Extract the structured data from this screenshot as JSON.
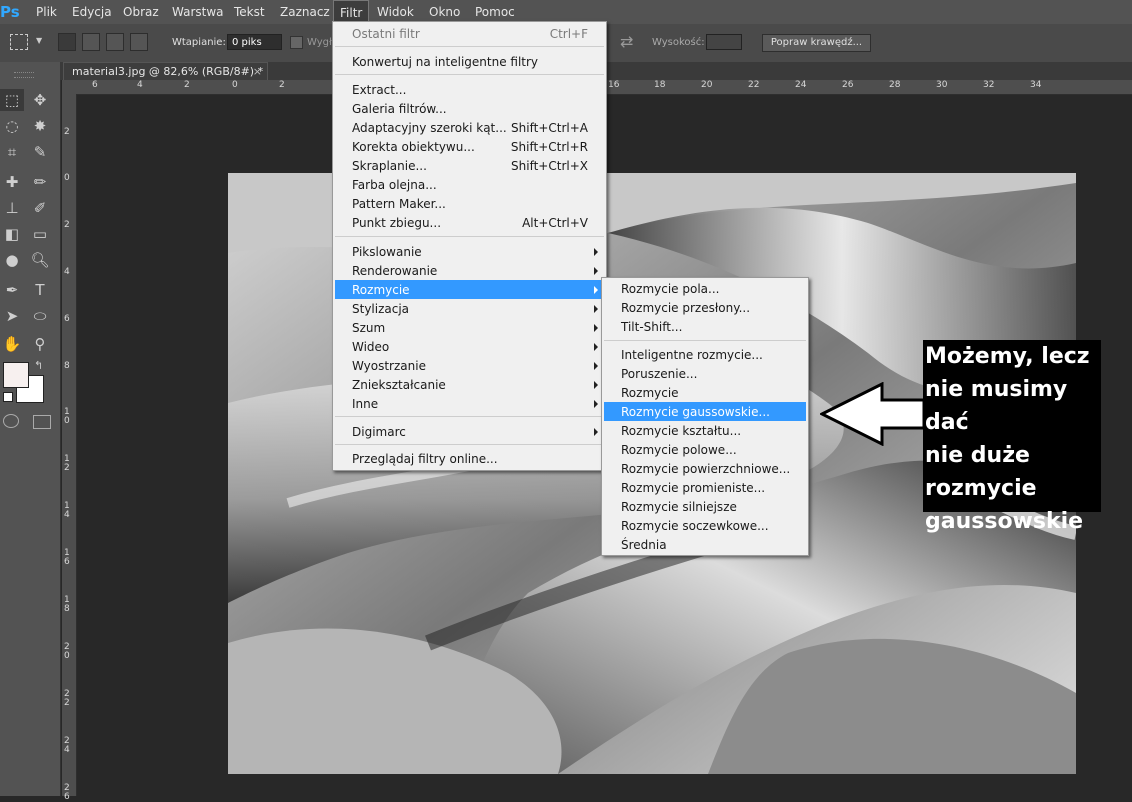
{
  "app": {
    "logo": "Ps"
  },
  "menubar": {
    "items": [
      "Plik",
      "Edycja",
      "Obraz",
      "Warstwa",
      "Tekst",
      "Zaznacz",
      "Filtr",
      "Widok",
      "Okno",
      "Pomoc"
    ],
    "active": "Filtr"
  },
  "options": {
    "feather_label": "Wtapianie:",
    "feather_value": "0 piks",
    "smooth_label": "Wygł",
    "height_label": "Wysokość:",
    "refine_button": "Popraw krawędź..."
  },
  "document": {
    "tab_title": "material3.jpg @ 82,6% (RGB/8#) *",
    "close_glyph": "×"
  },
  "rulers": {
    "h_ticks": [
      "6",
      "4",
      "2",
      "0",
      "2",
      "16",
      "18",
      "20",
      "22",
      "24",
      "26",
      "28",
      "30",
      "32",
      "34"
    ],
    "v_ticks": [
      "2",
      "0",
      "2",
      "4",
      "6",
      "8",
      "10",
      "12",
      "14",
      "16",
      "18",
      "20",
      "22",
      "24",
      "26"
    ]
  },
  "filter_menu": {
    "last_filter": {
      "label": "Ostatni filtr",
      "shortcut": "Ctrl+F"
    },
    "convert": "Konwertuj na inteligentne filtry",
    "group1": [
      {
        "label": "Extract...",
        "shortcut": ""
      },
      {
        "label": "Galeria filtrów...",
        "shortcut": ""
      },
      {
        "label": "Adaptacyjny szeroki kąt...",
        "shortcut": "Shift+Ctrl+A"
      },
      {
        "label": "Korekta obiektywu...",
        "shortcut": "Shift+Ctrl+R"
      },
      {
        "label": "Skraplanie...",
        "shortcut": "Shift+Ctrl+X"
      },
      {
        "label": "Farba olejna...",
        "shortcut": ""
      },
      {
        "label": "Pattern Maker...",
        "shortcut": ""
      },
      {
        "label": "Punkt zbiegu...",
        "shortcut": "Alt+Ctrl+V"
      }
    ],
    "group2": [
      "Pikslowanie",
      "Renderowanie",
      "Rozmycie",
      "Stylizacja",
      "Szum",
      "Wideo",
      "Wyostrzanie",
      "Zniekształcanie",
      "Inne"
    ],
    "digimarc": "Digimarc",
    "browse": "Przeglądaj filtry online...",
    "highlighted": "Rozmycie"
  },
  "blur_submenu": {
    "group1": [
      "Rozmycie pola...",
      "Rozmycie przesłony...",
      "Tilt-Shift..."
    ],
    "group2": [
      "Inteligentne rozmycie...",
      "Poruszenie...",
      "Rozmycie",
      "Rozmycie gaussowskie...",
      "Rozmycie kształtu...",
      "Rozmycie polowe...",
      "Rozmycie powierzchniowe...",
      "Rozmycie promieniste...",
      "Rozmycie silniejsze",
      "Rozmycie soczewkowe...",
      "Średnia"
    ],
    "highlighted": "Rozmycie gaussowskie..."
  },
  "annotation": {
    "lines": [
      "Możemy, lecz",
      "nie musimy dać",
      "nie duże",
      "rozmycie",
      "gaussowskie"
    ]
  },
  "colors": {
    "highlight": "#3399ff",
    "menu_bg": "#f0f0f0",
    "ui_dark": "#535353"
  }
}
